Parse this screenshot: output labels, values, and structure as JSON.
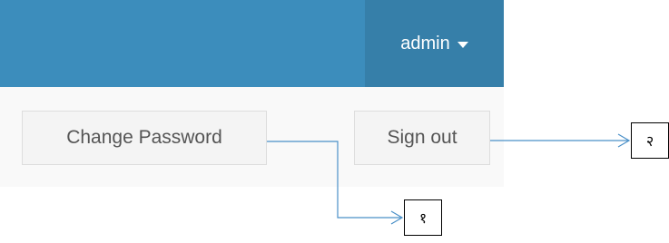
{
  "header": {
    "user_label": "admin",
    "bar_color": "#3c8dbc",
    "user_menu_color": "#367fa9"
  },
  "dropdown": {
    "change_password_label": "Change Password",
    "sign_out_label": "Sign out"
  },
  "annotations": {
    "callout_1": "१",
    "callout_2": "२",
    "line_color": "#4a90c8"
  }
}
